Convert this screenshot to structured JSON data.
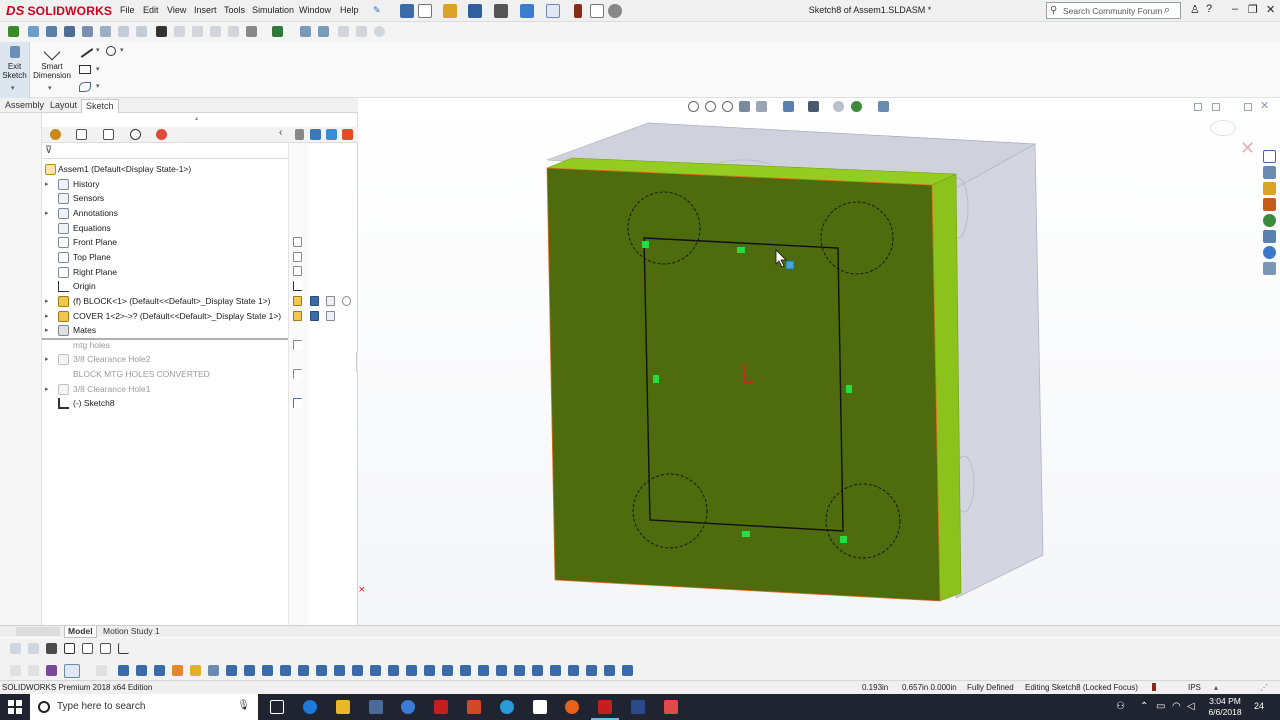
{
  "app": {
    "brand": "SOLIDWORKS",
    "document_title": "Sketch8 of Assem1.SLDASM *"
  },
  "menu": [
    "File",
    "Edit",
    "View",
    "Insert",
    "Tools",
    "Simulation",
    "Window",
    "Help"
  ],
  "search": {
    "placeholder": "Search Community Forum"
  },
  "window_controls": [
    "?",
    "–",
    "❐",
    "✕"
  ],
  "command_manager": {
    "exit_sketch_label": "Exit Sketch",
    "smart_dimension_label": "Smart Dimension"
  },
  "command_tabs": [
    {
      "label": "Assembly",
      "active": false
    },
    {
      "label": "Layout",
      "active": false
    },
    {
      "label": "Sketch",
      "active": true
    }
  ],
  "feature_tree": [
    {
      "label": "Assem1  (Default<Display State-1>)",
      "expand": false,
      "level": 0,
      "grayed": false
    },
    {
      "label": "History",
      "expand": true,
      "level": 1,
      "grayed": false
    },
    {
      "label": "Sensors",
      "expand": false,
      "level": 1,
      "grayed": false
    },
    {
      "label": "Annotations",
      "expand": true,
      "level": 1,
      "grayed": false
    },
    {
      "label": "Equations",
      "expand": false,
      "level": 1,
      "grayed": false
    },
    {
      "label": "Front Plane",
      "expand": false,
      "level": 1,
      "grayed": false
    },
    {
      "label": "Top Plane",
      "expand": false,
      "level": 1,
      "grayed": false
    },
    {
      "label": "Right Plane",
      "expand": false,
      "level": 1,
      "grayed": false
    },
    {
      "label": "Origin",
      "expand": false,
      "level": 1,
      "grayed": false
    },
    {
      "label": "(f) BLOCK<1> (Default<<Default>_Display State 1>)",
      "expand": true,
      "level": 1,
      "grayed": false
    },
    {
      "label": "COVER 1<2>->? (Default<<Default>_Display State 1>)",
      "expand": true,
      "level": 1,
      "grayed": false
    },
    {
      "label": "Mates",
      "expand": true,
      "level": 1,
      "grayed": false
    },
    {
      "label": "mtg holes",
      "expand": false,
      "level": 1,
      "grayed": true
    },
    {
      "label": "3/8 Clearance Hole2",
      "expand": true,
      "level": 1,
      "grayed": true
    },
    {
      "label": "BLOCK MTG HOLES CONVERTED",
      "expand": false,
      "level": 1,
      "grayed": true
    },
    {
      "label": "3/8 Clearance Hole1",
      "expand": true,
      "level": 1,
      "grayed": true
    },
    {
      "label": "(-) Sketch8",
      "expand": false,
      "level": 1,
      "grayed": false
    }
  ],
  "bottom_tabs": [
    {
      "label": "Model",
      "active": true
    },
    {
      "label": "Motion Study 1",
      "active": false
    }
  ],
  "status_bar": {
    "edition": "SOLIDWORKS Premium 2018 x64 Edition",
    "x_coord": "0.193in",
    "y_coord": "0.657in 0.000in",
    "state": "Fully Defined",
    "editing": "Editing Sketch8 (Locked Focus)",
    "units": "IPS"
  },
  "taskbar": {
    "search_placeholder": "Type here to search",
    "time": "3:04 PM",
    "date": "6/6/2018",
    "notification_count": "24"
  },
  "colors": {
    "face_green": "#4e6b0e",
    "side_green": "#8cc21c",
    "box_gray": "#d3d5e0",
    "sketch_green": "#22dd44",
    "brand_red": "#d0021b"
  }
}
